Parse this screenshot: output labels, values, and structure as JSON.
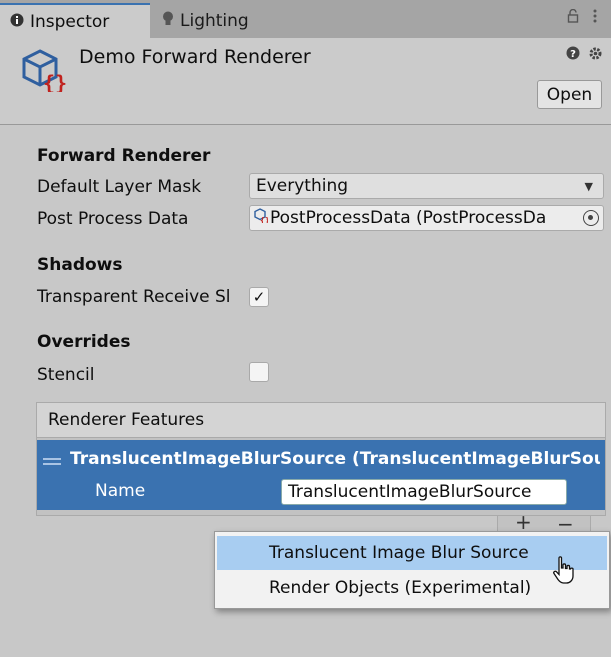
{
  "tabs": [
    {
      "label": "Inspector",
      "icon": "info-icon"
    },
    {
      "label": "Lighting",
      "icon": "bulb-icon"
    }
  ],
  "header": {
    "title": "Demo Forward Renderer",
    "open_label": "Open"
  },
  "forward_renderer": {
    "section_label": "Forward Renderer",
    "default_layer_mask_label": "Default Layer Mask",
    "default_layer_mask_value": "Everything",
    "post_process_data_label": "Post Process Data",
    "post_process_data_value": "PostProcessData (PostProcessDa"
  },
  "shadows": {
    "section_label": "Shadows",
    "transparent_receive_label": "Transparent Receive Sl",
    "transparent_receive_checked": "✓"
  },
  "overrides": {
    "section_label": "Overrides",
    "stencil_label": "Stencil"
  },
  "renderer_features": {
    "header": "Renderer Features",
    "item_title": "TranslucentImageBlurSource (TranslucentImageBlurSou",
    "name_label": "Name",
    "name_value": "TranslucentImageBlurSource",
    "add_label": "+",
    "remove_label": "−"
  },
  "menu": {
    "items": [
      "Translucent Image Blur Source",
      "Render Objects (Experimental)"
    ]
  },
  "colors": {
    "accent": "#3a72b0",
    "menu_highlight": "#a8cdf1"
  }
}
